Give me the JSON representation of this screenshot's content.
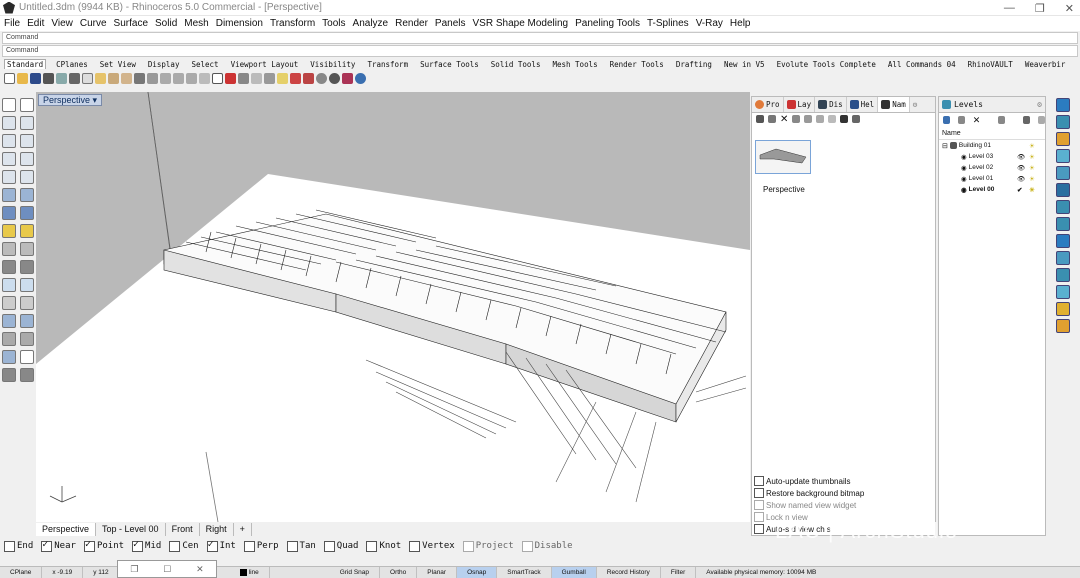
{
  "window": {
    "title": "Untitled.3dm (9944 KB) - Rhinoceros 5.0 Commercial - [Perspective]"
  },
  "menu": [
    "File",
    "Edit",
    "View",
    "Curve",
    "Surface",
    "Solid",
    "Mesh",
    "Dimension",
    "Transform",
    "Tools",
    "Analyze",
    "Render",
    "Panels",
    "VSR Shape Modeling",
    "Paneling Tools",
    "T-Splines",
    "V-Ray",
    "Help"
  ],
  "command": {
    "line1": "Command",
    "line2": "Command"
  },
  "toolbar_tabs": [
    "Standard",
    "CPlanes",
    "Set View",
    "Display",
    "Select",
    "Viewport Layout",
    "Visibility",
    "Transform",
    "Surface Tools",
    "Solid Tools",
    "Mesh Tools",
    "Render Tools",
    "Drafting",
    "New in V5",
    "Evolute Tools Complete",
    "All Commands 04",
    "RhinoVAULT",
    "Weaverbir"
  ],
  "viewport": {
    "label": "Perspective",
    "dropdown": "▾"
  },
  "viewport_tabs": [
    "Perspective",
    "Top - Level 00",
    "Front",
    "Right",
    "+"
  ],
  "osnaps": [
    {
      "label": "End",
      "checked": false
    },
    {
      "label": "Near",
      "checked": true
    },
    {
      "label": "Point",
      "checked": true
    },
    {
      "label": "Mid",
      "checked": true
    },
    {
      "label": "Cen",
      "checked": false
    },
    {
      "label": "Int",
      "checked": true
    },
    {
      "label": "Perp",
      "checked": false
    },
    {
      "label": "Tan",
      "checked": false
    },
    {
      "label": "Quad",
      "checked": false
    },
    {
      "label": "Knot",
      "checked": false
    },
    {
      "label": "Vertex",
      "checked": false
    },
    {
      "label": "Project",
      "checked": false
    },
    {
      "label": "Disable",
      "checked": false
    }
  ],
  "status": {
    "cplane": "CPlane",
    "x": "x -9.19",
    "y": "y 112",
    "layer": "line",
    "grid_snap": "Grid Snap",
    "ortho": "Ortho",
    "planar": "Planar",
    "osnap": "Osnap",
    "smarttrack": "SmartTrack",
    "gumball": "Gumball",
    "record_history": "Record History",
    "filter": "Filter",
    "memory": "Available physical memory: 10094 MB"
  },
  "named_views_panel": {
    "tabs": [
      "Pro",
      "Lay",
      "Dis",
      "Hel",
      "Nam"
    ],
    "view_name": "Perspective",
    "options": [
      {
        "label": "Auto-update thumbnails",
        "checked": false
      },
      {
        "label": "Restore background bitmap",
        "checked": false
      },
      {
        "label": "Show named view widget",
        "checked": false
      },
      {
        "label": "Lock n    view",
        "checked": false
      },
      {
        "label": "Auto-s      d view ch   s",
        "checked": false
      }
    ]
  },
  "levels_panel": {
    "title": "Levels",
    "column": "Name",
    "building": "Building 01",
    "levels": [
      {
        "name": "Level 03",
        "bold": false
      },
      {
        "name": "Level 02",
        "bold": false
      },
      {
        "name": "Level 01",
        "bold": false
      },
      {
        "name": "Level 00",
        "bold": true
      }
    ]
  },
  "watermark": "LAC | ArchStudio",
  "colors": {
    "viewport_bg": "#b9b9b9",
    "ground": "#ffffff",
    "accent": "#3a6fb0"
  }
}
